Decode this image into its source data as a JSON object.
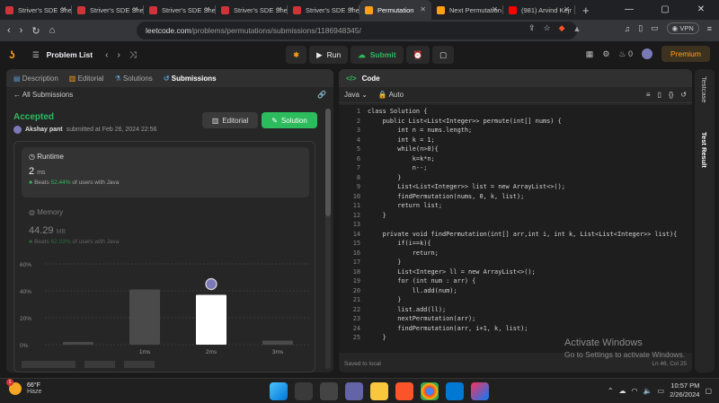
{
  "browser": {
    "tabs": [
      {
        "title": "Striver's SDE Shee",
        "icon_color": "#d13438"
      },
      {
        "title": "Striver's SDE Shee",
        "icon_color": "#d13438"
      },
      {
        "title": "Striver's SDE Shee",
        "icon_color": "#d13438"
      },
      {
        "title": "Striver's SDE Shee",
        "icon_color": "#d13438"
      },
      {
        "title": "Striver's SDE Shee",
        "icon_color": "#d13438"
      },
      {
        "title": "Permutation",
        "icon_color": "#ffa116"
      },
      {
        "title": "Next Permutation",
        "icon_color": "#ffa116"
      },
      {
        "title": "(981) Arvind Kejr",
        "icon_color": "#ff0000"
      }
    ],
    "url_domain": "leetcode.com",
    "url_path": "/problems/permutations/submissions/1186948345/",
    "vpn_label": "VPN"
  },
  "header": {
    "problem_list": "Problem List",
    "run": "Run",
    "submit": "Submit",
    "notif_count": "0",
    "premium": "Premium"
  },
  "left_tabs": [
    "Description",
    "Editorial",
    "Solutions",
    "Submissions"
  ],
  "all_submissions": "All Submissions",
  "submission": {
    "status": "Accepted",
    "user": "Akshay pant",
    "submitted_text": "submitted at Feb 26, 2024 22:56",
    "editorial_btn": "Editorial",
    "solution_btn": "Solution",
    "runtime_label": "Runtime",
    "runtime_value": "2",
    "runtime_unit": "ms",
    "runtime_beats_prefix": "Beats",
    "runtime_beats": "52.44%",
    "runtime_beats_suffix": "of users with Java",
    "memory_label": "Memory",
    "memory_value": "44.29",
    "memory_unit": "MB",
    "memory_beats_prefix": "Beats",
    "memory_beats": "62.03%",
    "memory_beats_suffix": "of users with Java"
  },
  "chart_data": {
    "type": "bar",
    "categories": [
      "",
      "1ms",
      "2ms",
      "3ms"
    ],
    "values": [
      2,
      41,
      37,
      3
    ],
    "highlight_index": 2,
    "yticks": [
      "0%",
      "20%",
      "40%",
      "60%"
    ],
    "ylim": [
      0,
      60
    ],
    "grid": true
  },
  "code_panel": {
    "title": "Code",
    "language": "Java",
    "mode": "Auto",
    "lines": [
      "class Solution {",
      "    public List<List<Integer>> permute(int[] nums) {",
      "        int n = nums.length;",
      "        int k = 1;",
      "        while(n>0){",
      "            k=k*n;",
      "            n--;",
      "        }",
      "        List<List<Integer>> list = new ArrayList<>();",
      "        findPermutation(nums, 0, k, list);",
      "        return list;",
      "    }",
      "",
      "    private void findPermutation(int[] arr,int i, int k, List<List<Integer>> list){",
      "        if(i==k){",
      "            return;",
      "        }",
      "        List<Integer> ll = new ArrayList<>();",
      "        for (int num : arr) {",
      "            ll.add(num);",
      "        }",
      "        list.add(ll);",
      "        nextPermutation(arr);",
      "        findPermutation(arr, i+1, k, list);",
      "    }"
    ],
    "saved": "Saved to local",
    "cursor": "Ln 46, Col 25"
  },
  "side": {
    "testcase": "Testcase",
    "test_result": "Test Result"
  },
  "watermark": {
    "line1": "Activate Windows",
    "line2": "Go to Settings to activate Windows."
  },
  "taskbar": {
    "temp": "66°F",
    "weather": "Haze",
    "alert_count": "1",
    "time": "10:57 PM",
    "date": "2/26/2024"
  }
}
